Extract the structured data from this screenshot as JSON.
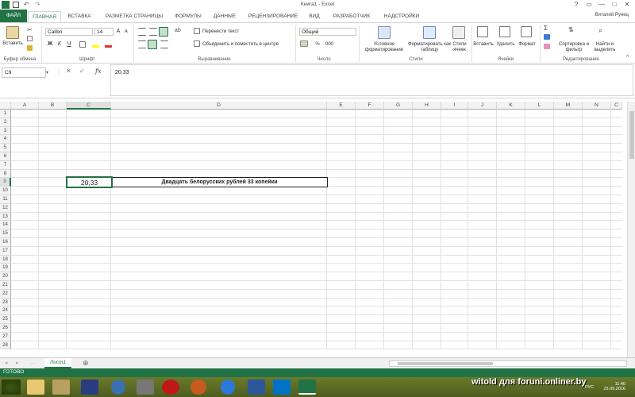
{
  "window": {
    "title": "Книга1 - Excel",
    "controls": [
      "?",
      "▭",
      "—",
      "□",
      "✕"
    ]
  },
  "tabs": {
    "items": [
      "ФАЙЛ",
      "ГЛАВНАЯ",
      "ВСТАВКА",
      "РАЗМЕТКА СТРАНИЦЫ",
      "ФОРМУЛЫ",
      "ДАННЫЕ",
      "РЕЦЕНЗИРОВАНИЕ",
      "ВИД",
      "РАЗРАБОТЧИК",
      "НАДСТРОЙКИ"
    ],
    "active": "ГЛАВНАЯ",
    "user": "Виталий Рунец"
  },
  "ribbon": {
    "clipboard": {
      "paste": "Вставить",
      "label": "Буфер обмена"
    },
    "font": {
      "name": "Calibri",
      "size": "14",
      "label": "Шрифт",
      "bold": "Ж",
      "italic": "К",
      "underline": "Ч",
      "grow": "A",
      "shrink": "A"
    },
    "alignment": {
      "wrap": "Перенести текст",
      "merge": "Объединить и поместить в центре",
      "label": "Выравнивание"
    },
    "number": {
      "format": "Общий",
      "label": "Число",
      "percent": "%",
      "thousands": "000"
    },
    "styles": {
      "conditional": "Условное форматирование",
      "as_table": "Форматировать как таблицу",
      "cell_styles": "Стили ячеек",
      "label": "Стили"
    },
    "cells": {
      "insert": "Вставить",
      "delete": "Удалить",
      "format": "Формат",
      "label": "Ячейки"
    },
    "editing": {
      "sort": "Сортировка и фильтр",
      "find": "Найти и выделить",
      "label": "Редактирование"
    }
  },
  "formula_bar": {
    "name_box": "C9",
    "cancel": "✕",
    "enter": "✓",
    "fx": "fx",
    "value": "20,33"
  },
  "grid": {
    "columns": [
      "A",
      "B",
      "C",
      "D",
      "E",
      "F",
      "G",
      "H",
      "I",
      "J",
      "K",
      "L",
      "M",
      "N",
      "C"
    ],
    "rows": [
      "1",
      "2",
      "3",
      "4",
      "5",
      "6",
      "7",
      "8",
      "9",
      "10",
      "11",
      "12",
      "13",
      "14",
      "15",
      "16",
      "17",
      "18",
      "19",
      "20",
      "21",
      "22",
      "23",
      "24",
      "25",
      "26",
      "27",
      "28"
    ],
    "selected_column": "C",
    "selected_row": "9",
    "cells": {
      "C9": "20,33",
      "D9": "Двадцать белорусских рублей 33 копейки"
    }
  },
  "sheets": {
    "active": "Лист1",
    "add": "⊕"
  },
  "status": {
    "text": "ГОТОВО"
  },
  "taskbar": {
    "watermark": "witold для foruni.onliner.by",
    "lang": "РУС",
    "time": "11:40",
    "date": "23.09.2016"
  },
  "colors": {
    "excel_green": "#217346",
    "border": "#222222"
  }
}
